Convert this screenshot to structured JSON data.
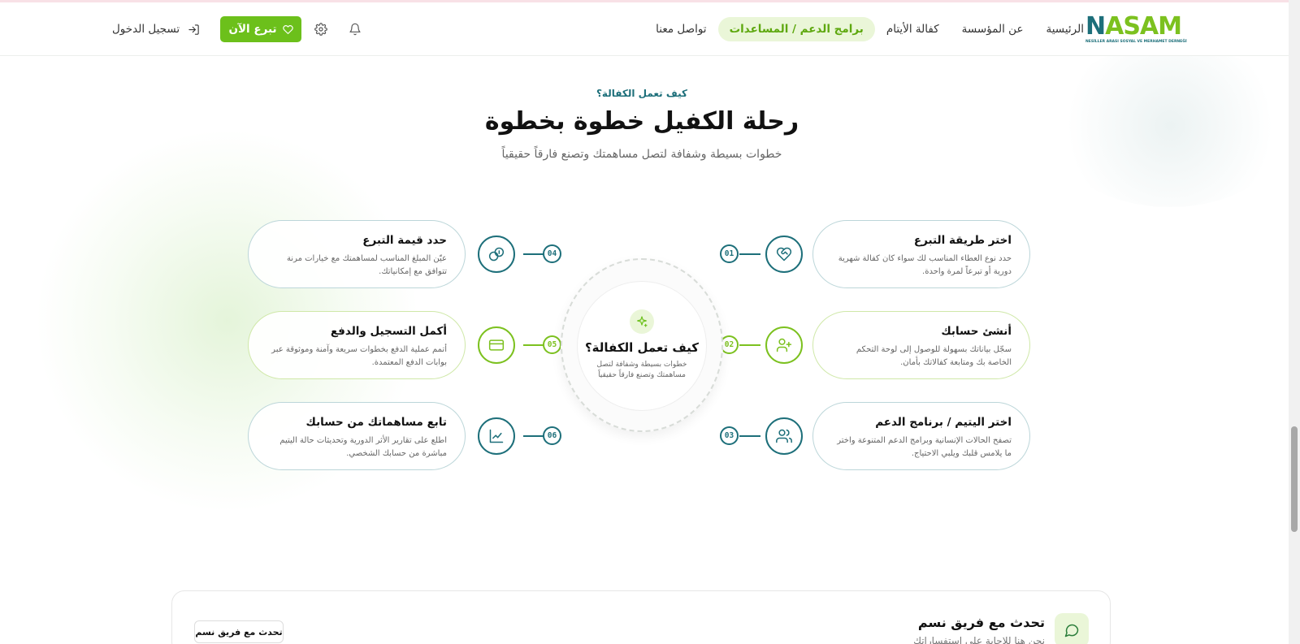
{
  "brand": {
    "logo_text_prefix": "N",
    "logo_text_rest": "ASAM",
    "logo_subtitle": "NESİLLER ARASI SOSYAL VE MERHAMET DERNEĞİ"
  },
  "nav": {
    "items": [
      "الرئيسية",
      "عن المؤسسة",
      "كفالة الأيتام",
      "برامج الدعم / المساعدات",
      "تواصل معنا"
    ],
    "active_index": 3
  },
  "header": {
    "donate_label": "تبرع الآن",
    "login_label": "تسجيل الدخول"
  },
  "section": {
    "eyebrow": "كيف تعمل الكفالة؟",
    "title": "رحلة الكفيل خطوة بخطوة",
    "subtitle": "خطوات بسيطة وشفافة لتصل مساهمتك وتصنع فارقاً حقيقياً"
  },
  "center": {
    "title": "كيف تعمل الكفالة؟",
    "desc": "خطوات بسيطة وشفافة لتصل مساهمتك وتصنع فارقاً حقيقياً"
  },
  "steps": [
    {
      "num": "01",
      "title": "اختر طريقة التبرع",
      "desc": "حدد نوع العطاء المناسب لك سواء كان كفالة شهرية دورية أو تبرعاً لمرة واحدة.",
      "icon": "heart-handshake-icon",
      "accent": "#1d6f7a"
    },
    {
      "num": "02",
      "title": "أنشئ حسابك",
      "desc": "سجّل بياناتك بسهولة للوصول إلى لوحة التحكم الخاصة بك ومتابعة كفالاتك بأمان.",
      "icon": "user-plus-icon",
      "accent": "#7cc11f"
    },
    {
      "num": "03",
      "title": "اختر اليتيم / برنامج الدعم",
      "desc": "تصفح الحالات الإنسانية وبرامج الدعم المتنوعة واختر ما يلامس قلبك ويلبي الاحتياج.",
      "icon": "users-icon",
      "accent": "#1d6f7a"
    },
    {
      "num": "04",
      "title": "حدد قيمة التبرع",
      "desc": "عيّن المبلغ المناسب لمساهمتك مع خيارات مرنة تتوافق مع إمكانياتك.",
      "icon": "coins-icon",
      "accent": "#1d6f7a"
    },
    {
      "num": "05",
      "title": "أكمل التسجيل والدفع",
      "desc": "أتمم عملية الدفع بخطوات سريعة وآمنة وموثوقة عبر بوابات الدفع المعتمدة.",
      "icon": "credit-card-icon",
      "accent": "#7cc11f"
    },
    {
      "num": "06",
      "title": "تابع مساهماتك من حسابك",
      "desc": "اطلع على تقارير الأثر الدورية وتحديثات حالة اليتيم مباشرة من حسابك الشخصي.",
      "icon": "chart-line-icon",
      "accent": "#1d6f7a"
    }
  ],
  "chat": {
    "title": "تحدث مع فريق نسم",
    "subtitle": "نحن هنا للإجابة على استفساراتك",
    "button_label": "تحدث مع فريق نسم"
  },
  "colors": {
    "brand_green": "#6cc01b",
    "brand_teal": "#1d6f7a"
  }
}
